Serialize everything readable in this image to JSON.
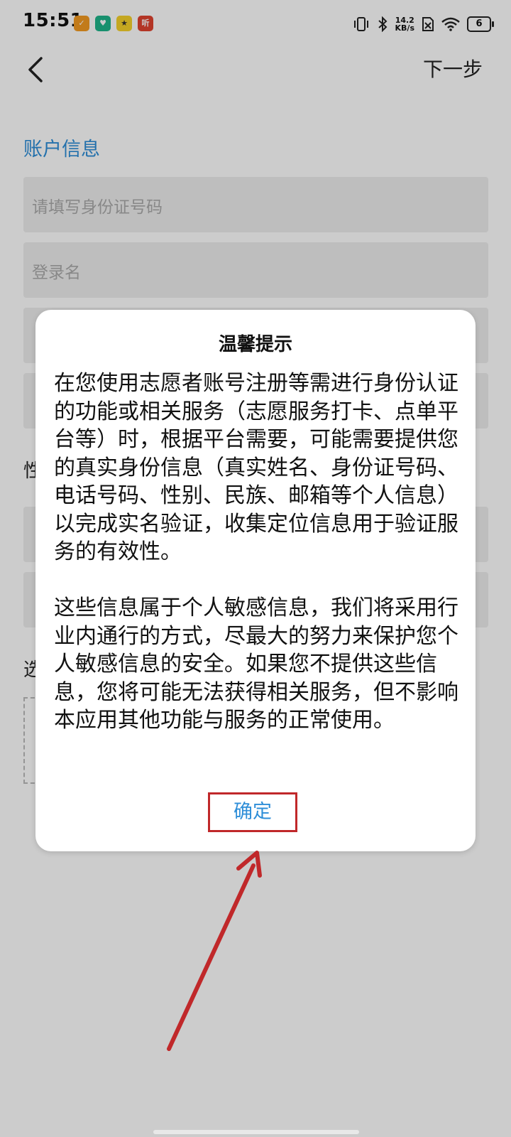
{
  "status_bar": {
    "time": "15:51",
    "speed_value": "14.2",
    "speed_unit": "KB/s",
    "battery": "6",
    "app_icons": [
      {
        "name": "app-icon-orange",
        "color": "#f39a21",
        "glyph": "✓"
      },
      {
        "name": "app-icon-green",
        "color": "#1fb58a",
        "glyph": "♥"
      },
      {
        "name": "app-icon-yellow",
        "color": "#f6d12a",
        "glyph": "★"
      },
      {
        "name": "app-icon-red",
        "color": "#e0432f",
        "glyph": "听"
      }
    ]
  },
  "nav": {
    "next_label": "下一步"
  },
  "form": {
    "section_title": "账户信息",
    "id_placeholder": "请填写身份证号码",
    "login_placeholder": "登录名",
    "gender_label": "性",
    "option_label": "选"
  },
  "dialog": {
    "title": "温馨提示",
    "paragraph1": "在您使用志愿者账号注册等需进行身份认证的功能或相关服务（志愿服务打卡、点单平台等）时，根据平台需要，可能需要提供您的真实身份信息（真实姓名、身份证号码、电话号码、性别、民族、邮箱等个人信息）以完成实名验证，收集定位信息用于验证服务的有效性。",
    "paragraph2": "这些信息属于个人敏感信息，我们将采用行业内通行的方式，尽最大的努力来保护您个人敏感信息的安全。如果您不提供这些信息，您将可能无法获得相关服务，但不影响本应用其他功能与服务的正常使用。",
    "confirm_label": "确定"
  },
  "colors": {
    "accent": "#2e8ed8",
    "highlight": "#c0282a"
  }
}
